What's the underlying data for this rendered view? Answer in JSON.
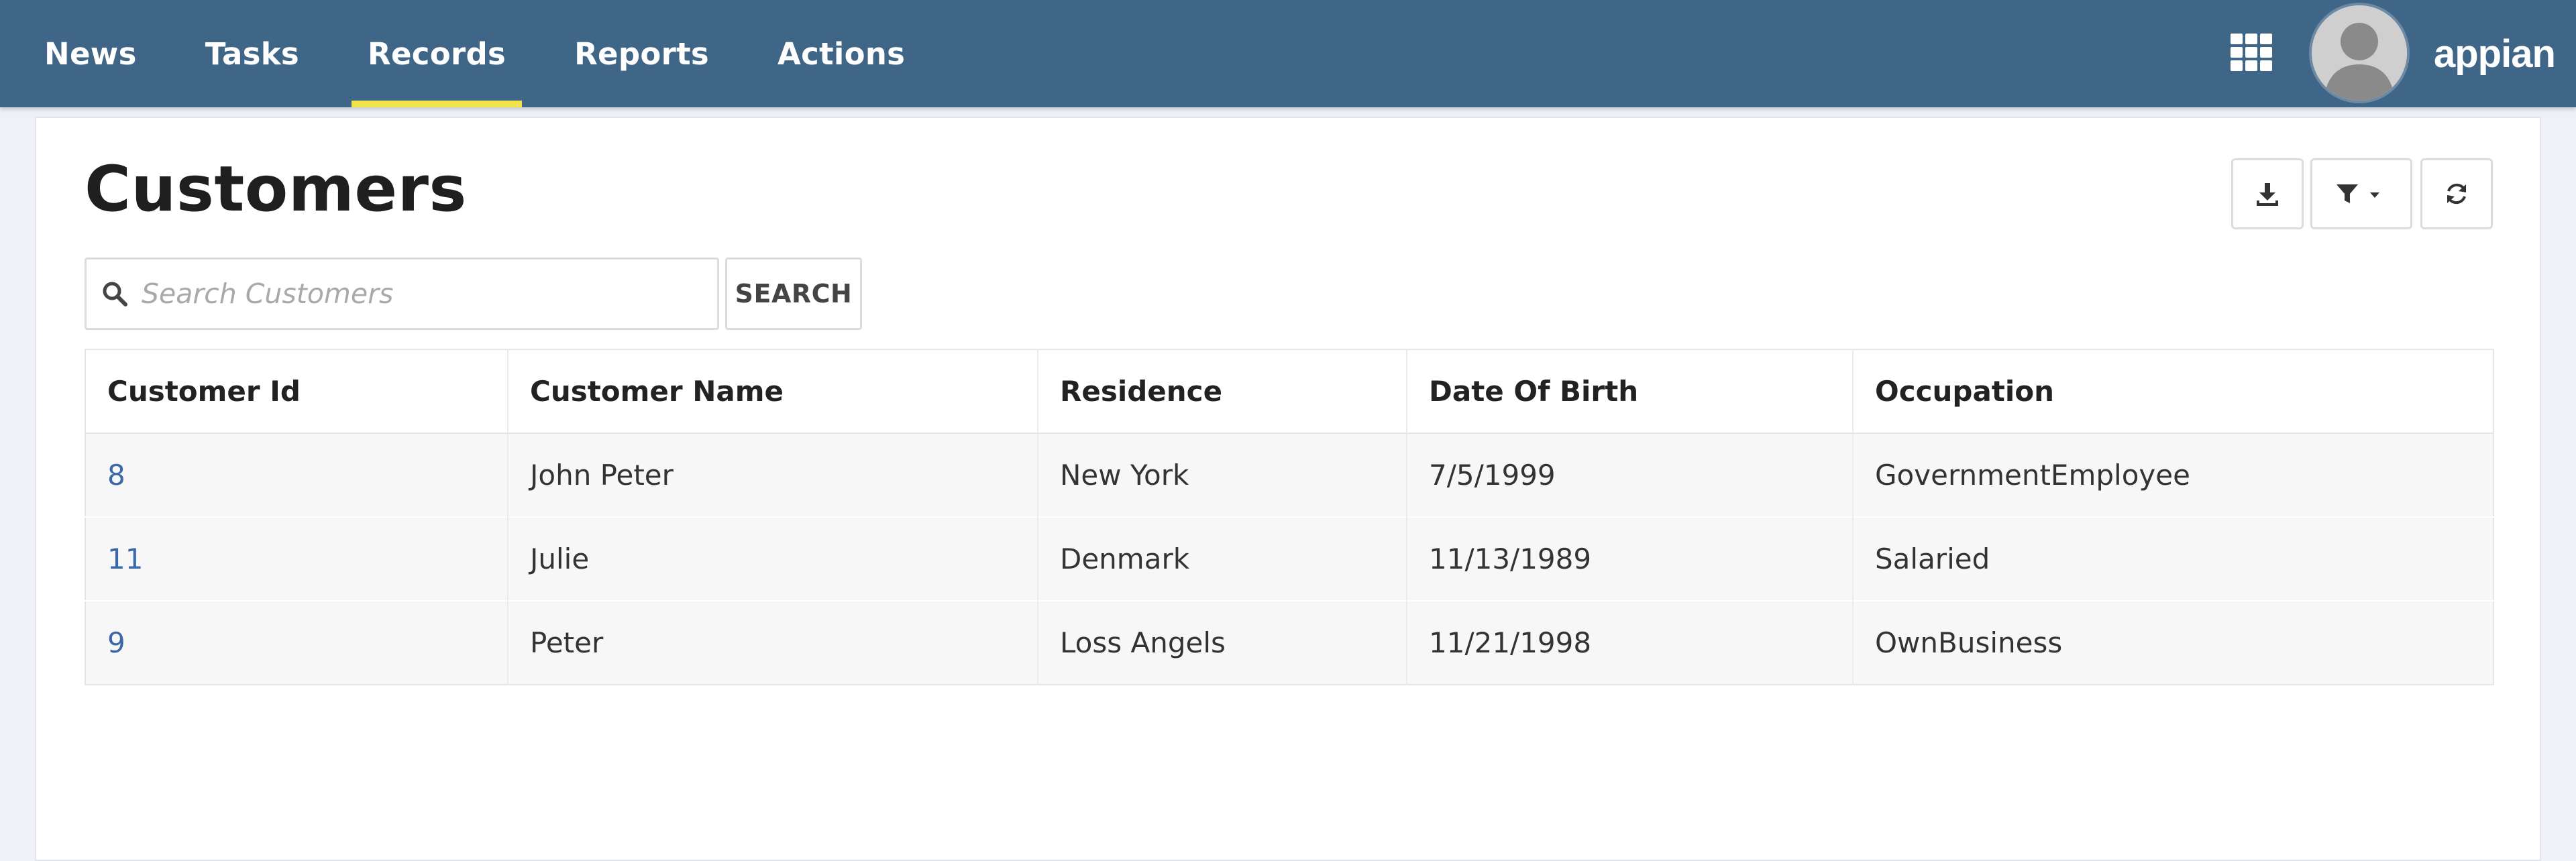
{
  "nav": {
    "tabs": [
      {
        "label": "News",
        "active": false
      },
      {
        "label": "Tasks",
        "active": false
      },
      {
        "label": "Records",
        "active": true
      },
      {
        "label": "Reports",
        "active": false
      },
      {
        "label": "Actions",
        "active": false
      }
    ],
    "icons": {
      "apps": "grid-apps-icon",
      "avatar": "user-avatar"
    },
    "brand": "appian",
    "colors": {
      "bar": "#3f6587",
      "active_underline": "#f3e34b"
    }
  },
  "page": {
    "title": "Customers",
    "toolbar": {
      "download_icon": "download-icon",
      "filter_icon": "filter-icon",
      "refresh_icon": "refresh-icon"
    },
    "search": {
      "placeholder": "Search Customers",
      "value": "",
      "button_label": "SEARCH"
    }
  },
  "table": {
    "columns": [
      "Customer Id",
      "Customer Name",
      "Residence",
      "Date Of Birth",
      "Occupation"
    ],
    "rows": [
      [
        "8",
        "John Peter",
        "New York",
        "7/5/1999",
        "GovernmentEmployee"
      ],
      [
        "11",
        "Julie",
        "Denmark",
        "11/13/1989",
        "Salaried"
      ],
      [
        "9",
        "Peter",
        "Loss Angels",
        "11/21/1998",
        "OwnBusiness"
      ]
    ],
    "link_color": "#3a68a8"
  }
}
